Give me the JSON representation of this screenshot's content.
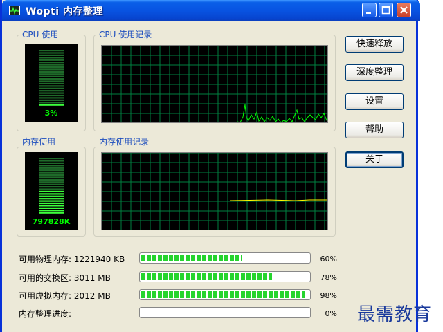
{
  "window": {
    "title": "Wopti 内存整理",
    "controls": [
      "minimize",
      "maximize",
      "close"
    ]
  },
  "cpu_meter": {
    "label": "CPU 使用",
    "value": "3%",
    "level_fraction": 0.03
  },
  "cpu_history": {
    "label": "CPU 使用记录"
  },
  "mem_meter": {
    "label": "内存使用",
    "value": "797828K",
    "level_fraction": 0.4
  },
  "mem_history": {
    "label": "内存使用记录"
  },
  "buttons": {
    "release": "快速释放",
    "deep": "深度整理",
    "settings": "设置",
    "help": "帮助",
    "about": "关于"
  },
  "stats": [
    {
      "label": "可用物理内存: 1221940 KB",
      "percent_text": "60%",
      "fraction": 0.6
    },
    {
      "label": "可用的交换区: 3011 MB",
      "percent_text": "78%",
      "fraction": 0.78
    },
    {
      "label": "可用虚拟内存: 2012 MB",
      "percent_text": "98%",
      "fraction": 0.98
    },
    {
      "label": "内存整理进度:",
      "percent_text": "0%",
      "fraction": 0
    }
  ],
  "watermark": "最需教育",
  "colors": {
    "titlebar": "#0854e2",
    "graph_grid": "#008040",
    "graph_line": "#00ff00",
    "mem_line": "#ffff00",
    "progress": "#26d42e",
    "label": "#1e4ebe"
  }
}
